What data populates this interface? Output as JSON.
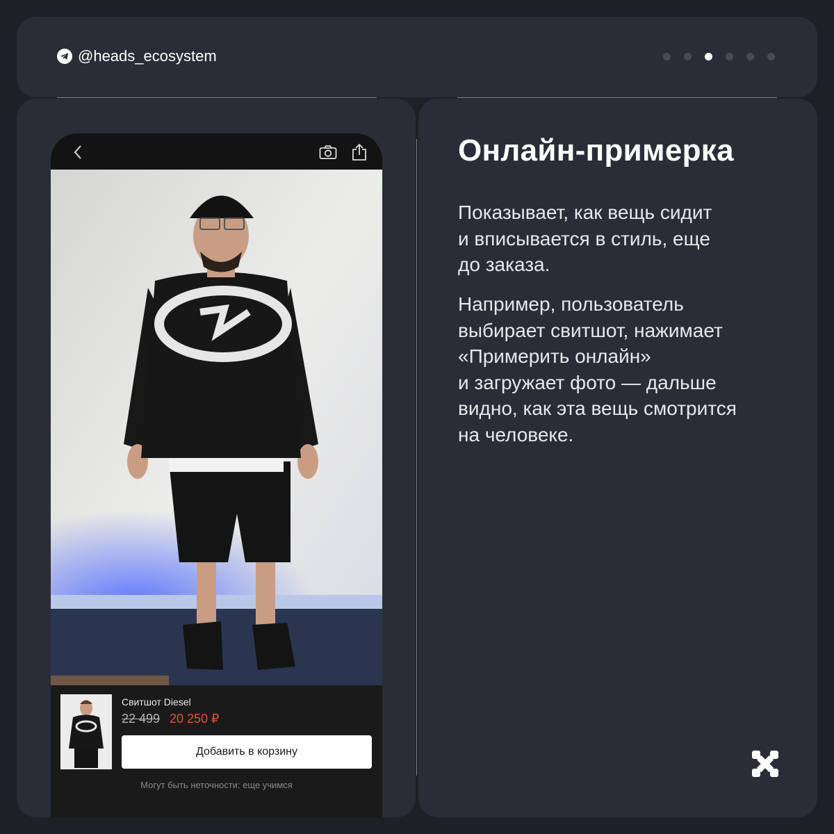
{
  "header": {
    "handle": "@heads_ecosystem",
    "pager": {
      "total": 6,
      "active_index": 2
    }
  },
  "phone": {
    "product": {
      "name": "Свитшот Diesel",
      "old_price": "22 499",
      "new_price": "20 250 ₽",
      "add_to_cart_label": "Добавить в корзину",
      "disclaimer": "Могут быть неточности: еще учимся"
    },
    "icons": [
      "chevron-left-icon",
      "camera-icon",
      "share-icon"
    ]
  },
  "content": {
    "title": "Онлайн-примерка",
    "paragraph1": [
      "Показывает, как вещь сидит",
      "и вписывается в стиль, еще",
      "до заказа."
    ],
    "paragraph2": [
      "Например, пользователь",
      "выбирает свитшот, нажимает",
      "«Примерить онлайн»",
      "и загружает фото — дальше",
      "видно, как эта вещь смотрится",
      "на человеке."
    ]
  },
  "colors": {
    "background": "#1e2028",
    "panel": "#2a2d37",
    "price_accent": "#e8502f"
  }
}
